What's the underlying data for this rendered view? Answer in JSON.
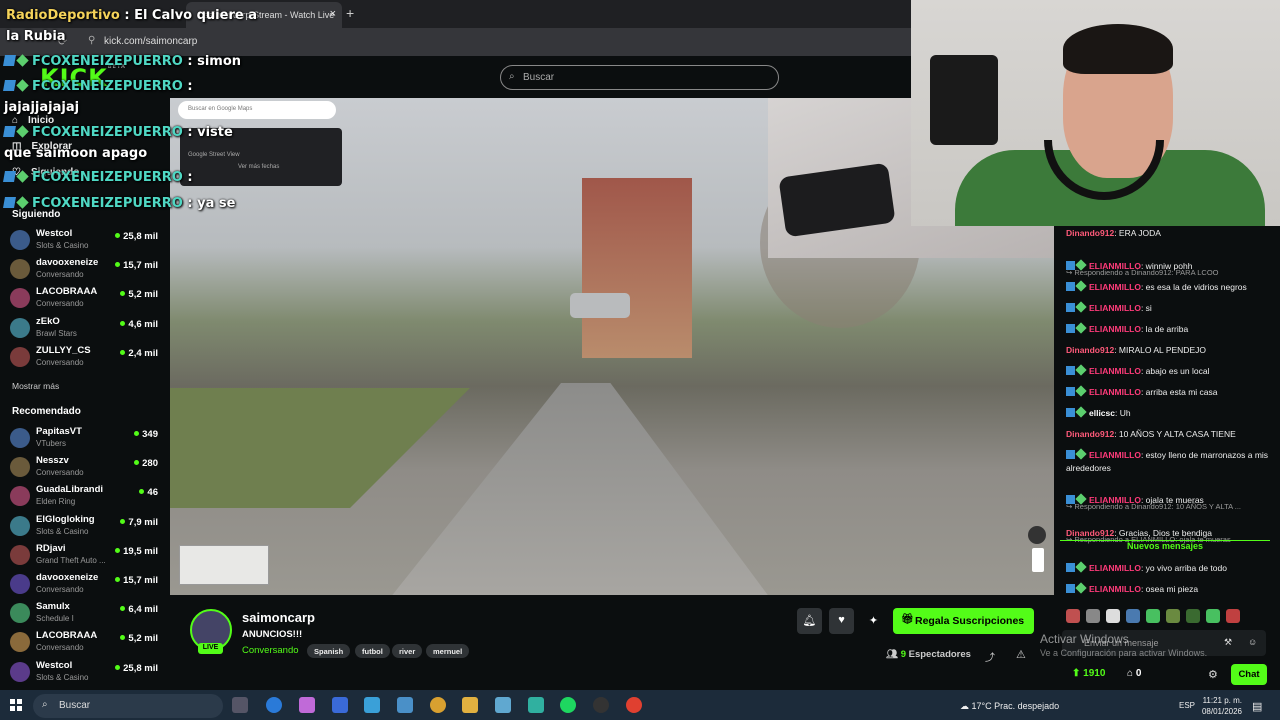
{
  "browser": {
    "tab_title": "saimoncarp Stream - Watch Live",
    "tab_close": "×",
    "new_tab": "+",
    "url": "kick.com/saimoncarp"
  },
  "kick": {
    "logo": "KICK",
    "logo_beta": "BETA",
    "search_placeholder": "Buscar"
  },
  "sidebar": {
    "nav": [
      {
        "label": "Inicio",
        "icon": "home-icon"
      },
      {
        "label": "Explorar",
        "icon": "compass-icon"
      },
      {
        "label": "Siguiendo",
        "icon": "heart-icon"
      }
    ],
    "following_header": "Siguiendo",
    "following": [
      {
        "name": "Westcol",
        "category": "Slots & Casino",
        "viewers": "25,8 mil"
      },
      {
        "name": "davooxeneize",
        "category": "Conversando",
        "viewers": "15,7 mil"
      },
      {
        "name": "LACOBRAAA",
        "category": "Conversando",
        "viewers": "5,2 mil"
      },
      {
        "name": "zEkO",
        "category": "Brawl Stars",
        "viewers": "4,6 mil"
      },
      {
        "name": "ZULLYY_CS",
        "category": "Conversando",
        "viewers": "2,4 mil"
      }
    ],
    "show_more": "Mostrar más",
    "recommended_header": "Recomendado",
    "recommended": [
      {
        "name": "PapitasVT",
        "category": "VTubers",
        "viewers": "349"
      },
      {
        "name": "Nesszv",
        "category": "Conversando",
        "viewers": "280"
      },
      {
        "name": "GuadaLibrandi",
        "category": "Elden Ring",
        "viewers": "46"
      },
      {
        "name": "ElGlogloking",
        "category": "Slots & Casino",
        "viewers": "7,9 mil"
      },
      {
        "name": "RDjavi",
        "category": "Grand Theft Auto ...",
        "viewers": "19,5 mil"
      },
      {
        "name": "davooxeneize",
        "category": "Conversando",
        "viewers": "15,7 mil"
      },
      {
        "name": "Samulx",
        "category": "Schedule I",
        "viewers": "6,4 mil"
      },
      {
        "name": "LACOBRAAA",
        "category": "Conversando",
        "viewers": "5,2 mil"
      },
      {
        "name": "Westcol",
        "category": "Slots & Casino",
        "viewers": "25,8 mil"
      }
    ]
  },
  "overlay": {
    "headline_a": "RadioDeportivo",
    "headline_b": " : El Calvo quiere a",
    "headline_c": "la Rubia",
    "messages": [
      {
        "user": "FCOXENEIZEPUERRO",
        "text": " : simon"
      },
      {
        "user": "FCOXENEIZEPUERRO",
        "text": " :"
      },
      {
        "user": "",
        "text": "jajajjajajaj"
      },
      {
        "user": "FCOXENEIZEPUERRO",
        "text": " : viste"
      },
      {
        "user": "",
        "text": "que saimoon apago"
      },
      {
        "user": "FCOXENEIZEPUERRO",
        "text": " :"
      },
      {
        "user": "FCOXENEIZEPUERRO",
        "text": " : ya se"
      }
    ]
  },
  "video": {
    "maps_search_placeholder": "Buscar en Google Maps",
    "maps_panel_title": "Google Street View",
    "maps_panel_sub": "Ver más fechas"
  },
  "stream": {
    "streamer": "saimoncarp",
    "live_badge": "LIVE",
    "title": "ANUNCIOS!!!",
    "category": "Conversando",
    "tags": [
      "Spanish",
      "futbol",
      "river",
      "mernuel"
    ],
    "subscribe_button": "Regala Suscripciones",
    "viewers_count": "9",
    "viewers_label": " Espectadores"
  },
  "chat": {
    "messages": [
      {
        "user": "Dinando912",
        "color": "#ff5a7a",
        "badges": false,
        "text": ": ERA JODA",
        "reply": ""
      },
      {
        "user": "ELIANMILLO",
        "color": "#ff3b7a",
        "badges": true,
        "text": ": winniw pohh",
        "reply": "↪ Respondiendo a Dinando912: PARA LCOO"
      },
      {
        "user": "ELIANMILLO",
        "color": "#ff3b7a",
        "badges": true,
        "text": ": es esa la de vidrios negros",
        "reply": ""
      },
      {
        "user": "ELIANMILLO",
        "color": "#ff3b7a",
        "badges": true,
        "text": ": si",
        "reply": ""
      },
      {
        "user": "ELIANMILLO",
        "color": "#ff3b7a",
        "badges": true,
        "text": ": la de arriba",
        "reply": ""
      },
      {
        "user": "Dinando912",
        "color": "#ff5a7a",
        "badges": false,
        "text": ": MIRALO AL PENDEJO",
        "reply": ""
      },
      {
        "user": "ELIANMILLO",
        "color": "#ff3b7a",
        "badges": true,
        "text": ": abajo es un local",
        "reply": ""
      },
      {
        "user": "ELIANMILLO",
        "color": "#ff3b7a",
        "badges": true,
        "text": ": arriba esta mi casa",
        "reply": ""
      },
      {
        "user": "ellicsc",
        "color": "#ffffff",
        "badges": true,
        "text": ": Uh",
        "reply": ""
      },
      {
        "user": "Dinando912",
        "color": "#ff5a7a",
        "badges": false,
        "text": ": 10 AÑOS Y ALTA CASA TIENE",
        "reply": ""
      },
      {
        "user": "ELIANMILLO",
        "color": "#ff3b7a",
        "badges": true,
        "text": ": estoy lleno de marronazos a mis alrededores",
        "reply": ""
      },
      {
        "user": "ELIANMILLO",
        "color": "#ff3b7a",
        "badges": true,
        "text": ": ojala te mueras",
        "reply": "↪ Respondiendo a Dinando912: 10 AÑOS Y ALTA ..."
      },
      {
        "user": "Dinando912",
        "color": "#ff5a7a",
        "badges": false,
        "text": ": Gracias, Dios te bendiga",
        "reply": "↪ Respondiendo a ELIANMILLO: ojala te mueras"
      }
    ],
    "new_messages_label": "Nuevos mensajes",
    "after": [
      {
        "user": "ELIANMILLO",
        "color": "#ff3b7a",
        "text": ": yo vivo arriba de todo"
      },
      {
        "user": "ELIANMILLO",
        "color": "#ff3b7a",
        "text": ": osea mi pieza"
      }
    ],
    "input_placeholder": "Enviar un mensaje",
    "points": "1910",
    "second_count": "0",
    "chat_button": "Chat"
  },
  "windows": {
    "activate_title": "Activar Windows",
    "activate_sub": "Ve a Configuración para activar Windows.",
    "search": "Buscar",
    "weather": "17°C  Prac. despejado",
    "lang": "ESP",
    "time": "11:21 p. m.",
    "date": "08/01/2026"
  },
  "colors": {
    "accent": "#53fc18",
    "background": "#0b0e0f",
    "chat_user_red": "#ff3b7a"
  }
}
